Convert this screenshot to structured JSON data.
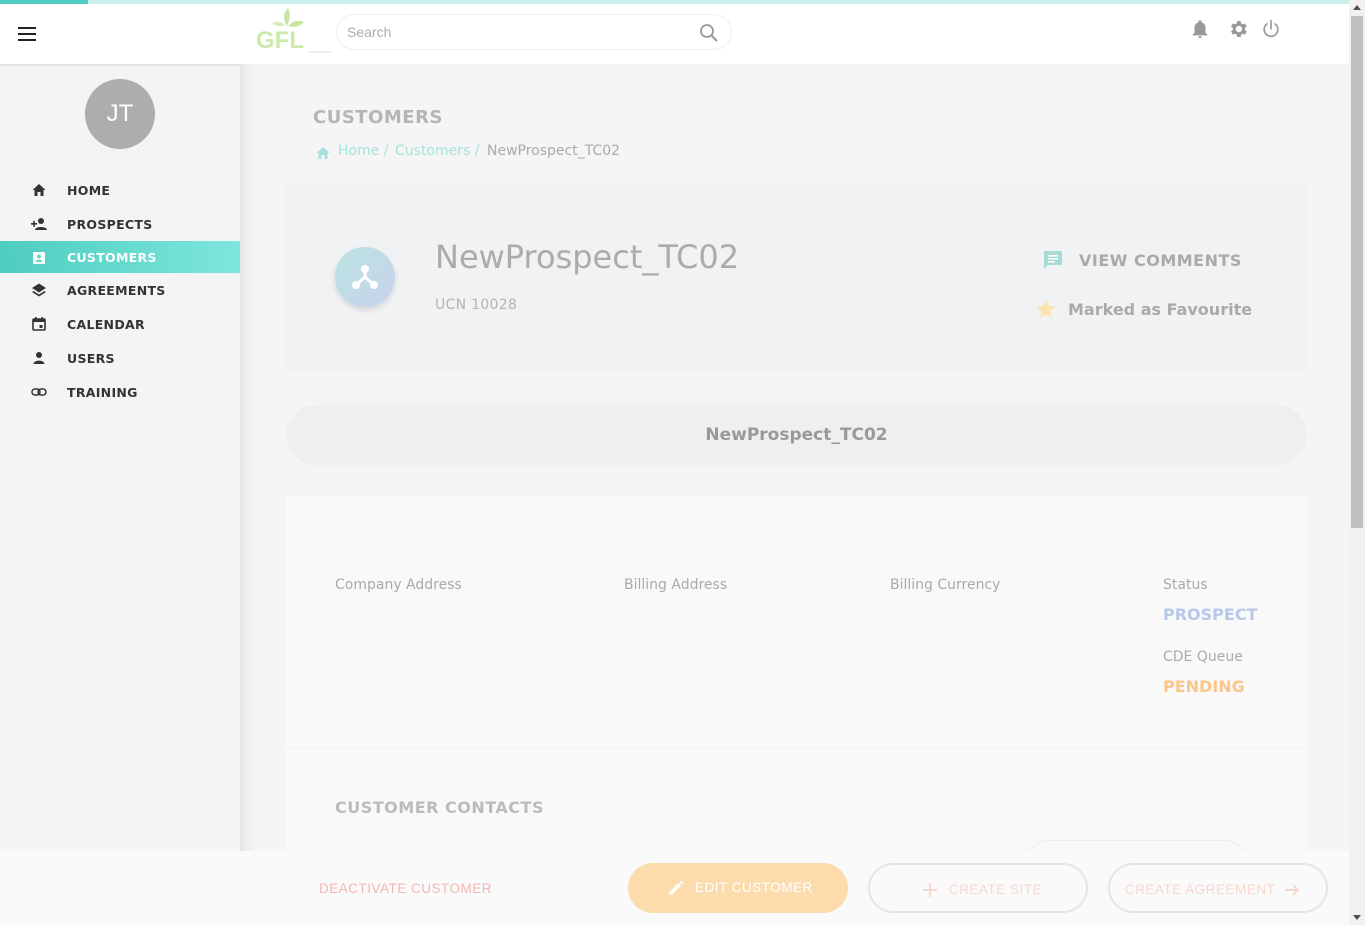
{
  "header": {
    "logo_text": "GFL",
    "search_placeholder": "Search"
  },
  "user": {
    "initials": "JT"
  },
  "sidebar": {
    "items": [
      {
        "label": "HOME",
        "icon": "home-icon",
        "active": false
      },
      {
        "label": "PROSPECTS",
        "icon": "add-person-icon",
        "active": false
      },
      {
        "label": "CUSTOMERS",
        "icon": "contact-card-icon",
        "active": true
      },
      {
        "label": "AGREEMENTS",
        "icon": "layers-icon",
        "active": false
      },
      {
        "label": "CALENDAR",
        "icon": "calendar-icon",
        "active": false
      },
      {
        "label": "USERS",
        "icon": "person-icon",
        "active": false
      },
      {
        "label": "TRAINING",
        "icon": "link-icon",
        "active": false
      }
    ]
  },
  "page": {
    "title": "CUSTOMERS",
    "breadcrumb": {
      "home": "Home /",
      "customers": "Customers /",
      "current": "NewProspect_TC02"
    }
  },
  "customer": {
    "name": "NewProspect_TC02",
    "ucn": "UCN 10028",
    "view_comments": "VIEW COMMENTS",
    "favourite": "Marked as Favourite",
    "name_bar": "NewProspect_TC02"
  },
  "details": {
    "company_address_label": "Company Address",
    "billing_address_label": "Billing Address",
    "billing_currency_label": "Billing Currency",
    "status_label": "Status",
    "status_value": "PROSPECT",
    "cde_queue_label": "CDE Queue",
    "cde_queue_value": "PENDING"
  },
  "contacts": {
    "title": "CUSTOMER CONTACTS"
  },
  "actions": {
    "deactivate": "DEACTIVATE CUSTOMER",
    "edit": "EDIT CUSTOMER",
    "create_site": "CREATE SITE",
    "create_agreement": "CREATE AGREEMENT"
  },
  "colors": {
    "accent": "#4ecdc0",
    "status_prospect": "#b8c8ea",
    "status_pending": "#fcc58a",
    "edit_button": "#fcdcad"
  }
}
